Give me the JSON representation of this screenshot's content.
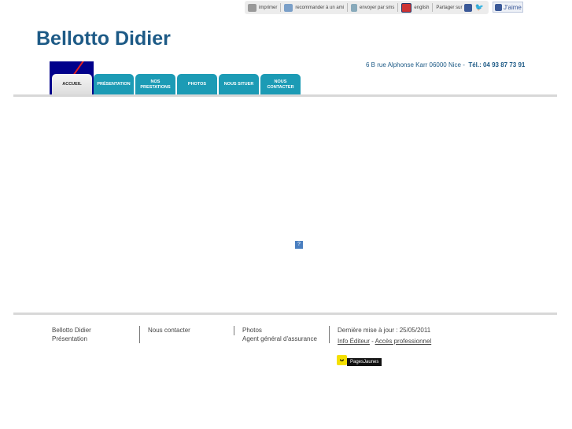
{
  "toolbar": {
    "print": "imprimer",
    "recommend": "recommander à un ami",
    "sms": "envoyer par sms",
    "english": "english",
    "share": "Partager sur",
    "like": "J'aime"
  },
  "header": {
    "title": "Bellotto Didier",
    "address": "6 B rue Alphonse Karr 06000 Nice",
    "tel": "Tél.: 04 93 87 73 91"
  },
  "nav": {
    "tabs": [
      {
        "label": "ACCUEIL"
      },
      {
        "label": "PRÉSENTATION"
      },
      {
        "label": "NOS\nPRESTATIONS"
      },
      {
        "label": "PHOTOS"
      },
      {
        "label": "NOUS SITUER"
      },
      {
        "label": "NOUS\nCONTACTER"
      }
    ]
  },
  "main": {
    "help": "?"
  },
  "footer": {
    "col1": [
      "Bellotto Didier",
      "Présentation"
    ],
    "col2": [
      "Nous contacter"
    ],
    "col3": [
      "Photos",
      "Agent général d'assurance"
    ],
    "updated": "Dernière mise à jour : 25/05/2011",
    "info": "Info Éditeur",
    "dash": " - ",
    "pro": "Accès professionnel",
    "pj": "PagesJaunes"
  },
  "colors": {
    "accent": "#1c9bb5",
    "title": "#1d5a86"
  }
}
